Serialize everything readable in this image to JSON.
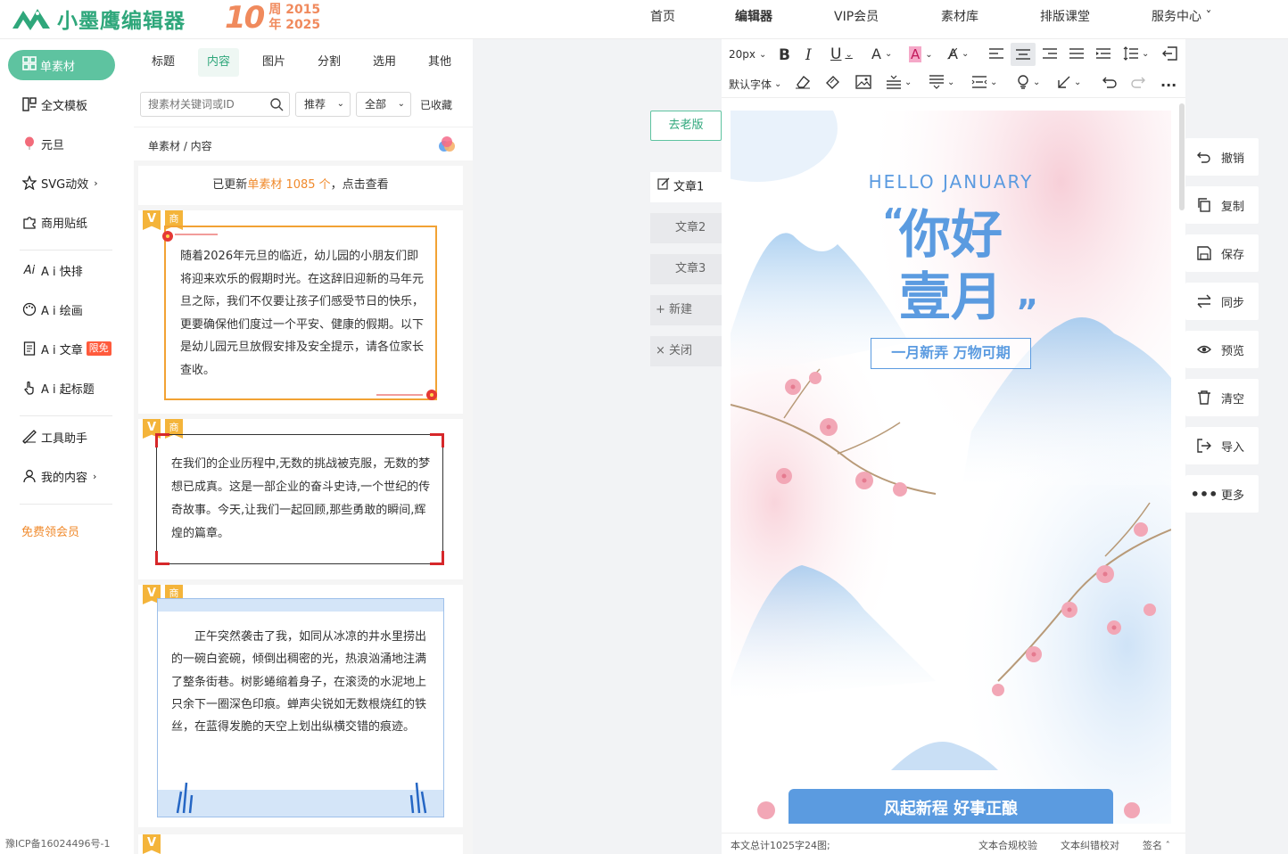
{
  "brand": {
    "name": "小墨鹰编辑器",
    "anniversary_num": "10",
    "anniversary_line1": "周 2015",
    "anniversary_line2": "年 2025"
  },
  "nav": [
    {
      "label": "首页"
    },
    {
      "label": "编辑器"
    },
    {
      "label": "VIP会员"
    },
    {
      "label": "素材库"
    },
    {
      "label": "排版课堂"
    },
    {
      "label": "服务中心 ˇ"
    }
  ],
  "sidebar": {
    "items": [
      {
        "label": "单素材"
      },
      {
        "label": "全文模板"
      },
      {
        "label": "元旦"
      },
      {
        "label": "SVG动效",
        "arrow": "›"
      },
      {
        "label": "商用贴纸"
      },
      {
        "label": "A i 快排"
      },
      {
        "label": "A i 绘画"
      },
      {
        "label": "A i 文章",
        "badge": "限免"
      },
      {
        "label": "A i 起标题"
      },
      {
        "label": "工具助手"
      },
      {
        "label": "我的内容",
        "arrow": "›"
      }
    ],
    "free_vip": "免费领会员",
    "icp": "豫ICP备16024496号-1"
  },
  "materials": {
    "tabs": [
      "标题",
      "内容",
      "图片",
      "分割",
      "选用",
      "其他"
    ],
    "search_placeholder": "搜素材关键词或ID",
    "sort": "推荐",
    "scope": "全部",
    "favorites": "已收藏",
    "breadcrumb": "单素材 / 内容",
    "update_prefix": "已更新",
    "update_highlight": "单素材 1085 个",
    "update_suffix": "，点击查看",
    "tag_v": "V",
    "tag_commercial": "商",
    "cards": [
      {
        "text": "随着2026年元旦的临近，幼儿园的小朋友们即将迎来欢乐的假期时光。在这辞旧迎新的马年元旦之际，我们不仅要让孩子们感受节日的快乐，更要确保他们度过一个平安、健康的假期。以下是幼儿园元旦放假安排及安全提示，请各位家长查收。"
      },
      {
        "text": "在我们的企业历程中,无数的挑战被克服，无数的梦想已成真。这是一部企业的奋斗史诗,一个世纪的传奇故事。今天,让我们一起回顾,那些勇敢的瞬间,辉煌的篇章。"
      },
      {
        "text": "正午突然袭击了我，如同从冰凉的井水里捞出的一碗白瓷碗，倾倒出稠密的光，热浪汹涌地注满了整条街巷。树影蜷缩着身子，在滚烫的水泥地上只余下一圈深色印痕。蝉声尖锐如无数根烧红的铁丝，在蓝得发脆的天空上划出纵横交错的痕迹。"
      }
    ]
  },
  "articles": {
    "old_version": "去老版",
    "tabs": [
      "文章1",
      "文章2",
      "文章3"
    ],
    "new": "+ 新建",
    "close": "× 关闭"
  },
  "editor": {
    "font_size": "20px",
    "font_family": "默认字体",
    "poster": {
      "hello": "HELLO JANUARY",
      "quote_open": "“",
      "line1": "你好",
      "line2": "壹月",
      "quote_close": "”",
      "subtitle": "一月新弄 万物可期",
      "banner": "风起新程 好事正酿"
    },
    "status_count": "本文总计1025字24图;",
    "status_compliance": "文本合规校验",
    "status_proofread": "文本纠错校对",
    "status_sign": "签名 ˆ"
  },
  "actions": [
    {
      "label": "撤销",
      "icon": "undo-icon"
    },
    {
      "label": "复制",
      "icon": "copy-icon"
    },
    {
      "label": "保存",
      "icon": "save-icon"
    },
    {
      "label": "同步",
      "icon": "sync-icon"
    },
    {
      "label": "预览",
      "icon": "eye-icon"
    },
    {
      "label": "清空",
      "icon": "trash-icon"
    },
    {
      "label": "导入",
      "icon": "import-icon"
    },
    {
      "label": "更多",
      "icon": "more-icon"
    }
  ],
  "colors": {
    "brand_green": "#2fa77b",
    "accent_orange": "#f08a2c",
    "poster_blue": "#5b9be0"
  }
}
